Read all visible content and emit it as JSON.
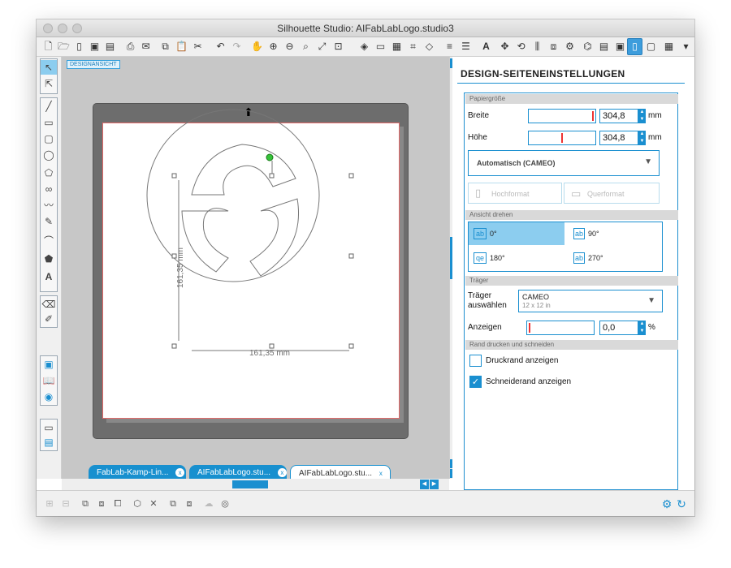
{
  "window": {
    "title": "Silhouette Studio: AIFabLabLogo.studio3"
  },
  "canvas": {
    "design_view_label": "DESIGNANSICHT",
    "dim_vertical": "161,35 mm",
    "dim_horizontal": "161,35 mm"
  },
  "tabs": [
    {
      "label": "FabLab-Kamp-Lin...",
      "close": "x"
    },
    {
      "label": "AIFabLabLogo.stu...",
      "close": "x"
    },
    {
      "label": "AIFabLabLogo.stu...",
      "close": "x"
    }
  ],
  "panel": {
    "title": "DESIGN-SEITENEINSTELLUNGEN",
    "paper": {
      "section": "Papiergröße",
      "width_label": "Breite",
      "width_value": "304,8",
      "width_unit": "mm",
      "height_label": "Höhe",
      "height_value": "304,8",
      "height_unit": "mm",
      "preset": "Automatisch (CAMEO)",
      "portrait": "Hochformat",
      "landscape": "Querformat"
    },
    "rotate": {
      "section": "Ansicht drehen",
      "r0": "0°",
      "r90": "90°",
      "r180": "180°",
      "r270": "270°"
    },
    "carrier": {
      "section": "Träger",
      "select_label_1": "Träger",
      "select_label_2": "auswählen",
      "select_value": "CAMEO",
      "select_sub": "12 x 12 in",
      "show_label": "Anzeigen",
      "show_value": "0,0",
      "show_unit": "%"
    },
    "border": {
      "section": "Rand drucken und schneiden",
      "print_border": "Druckrand anzeigen",
      "cut_border": "Schneiderand anzeigen"
    }
  },
  "colors": {
    "accent": "#1a8fd0",
    "tab_active_border": "#1890cf",
    "selected_rotation": "#8ccdef"
  }
}
